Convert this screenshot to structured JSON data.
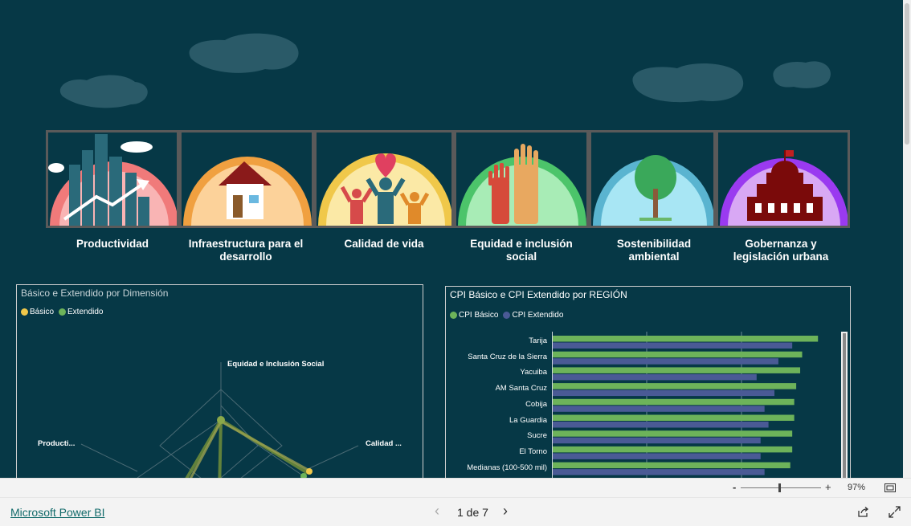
{
  "dimensions": [
    {
      "label": "Productividad",
      "color": "#f07a7a"
    },
    {
      "label": "Infraestructura para el desarrollo",
      "color": "#f0a040"
    },
    {
      "label": "Calidad de vida",
      "color": "#f0c84a"
    },
    {
      "label": "Equidad e inclusión social",
      "color": "#4cc46a"
    },
    {
      "label": "Sostenibilidad ambiental",
      "color": "#5ab4d0"
    },
    {
      "label": "Gobernanza y legislación urbana",
      "color": "#9a3af0"
    }
  ],
  "radar": {
    "title": "Básico e Extendido por Dimensión",
    "legend": [
      {
        "label": "Básico",
        "color": "#f0c84a"
      },
      {
        "label": "Extendido",
        "color": "#6db35a"
      }
    ],
    "axis_labels": {
      "top": "Equidad e Inclusión Social",
      "left": "Producti...",
      "right": "Calidad ..."
    }
  },
  "chart_data": {
    "type": "bar",
    "title": "CPI Básico e CPI Extendido por REGIÓN",
    "categories": [
      "Tarija",
      "Santa Cruz de la Sierra",
      "Yacuiba",
      "AM Santa Cruz",
      "Cobija",
      "La Guardia",
      "Sucre",
      "El Torno",
      "Medianas (100-500 mil)"
    ],
    "series": [
      {
        "name": "CPI Básico",
        "color": "#6db35a",
        "values": [
          0.67,
          0.63,
          0.625,
          0.615,
          0.61,
          0.61,
          0.605,
          0.605,
          0.6
        ]
      },
      {
        "name": "CPI Extendido",
        "color": "#4a5a95",
        "values": [
          0.605,
          0.57,
          0.515,
          0.56,
          0.535,
          0.545,
          0.525,
          0.525,
          0.535
        ]
      }
    ],
    "xlim": [
      0,
      0.7
    ],
    "grid": true,
    "legend_position": "top-left"
  },
  "zoom": {
    "minus": "-",
    "plus": "+",
    "level": "97%"
  },
  "footer": {
    "brand": "Microsoft Power BI",
    "page_indicator": "1 de 7",
    "prev": "‹",
    "next": "›"
  }
}
